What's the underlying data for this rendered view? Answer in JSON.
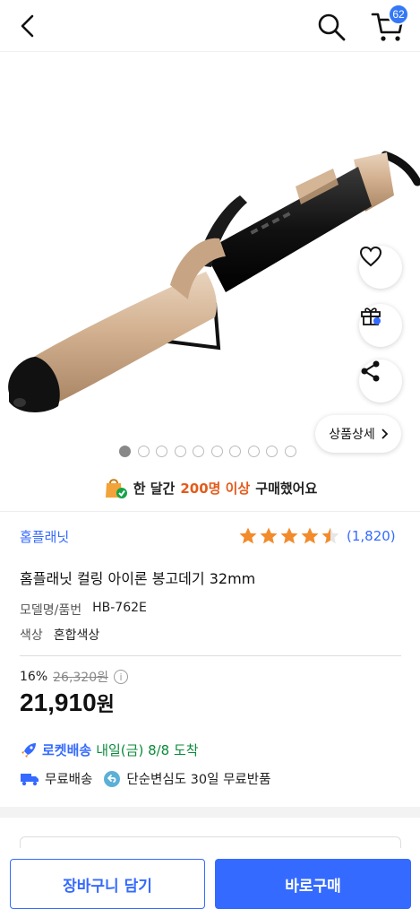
{
  "header": {
    "cart_count": "62"
  },
  "image_detail_label": "상품상세",
  "carousel": {
    "total": 10,
    "active_index": 0
  },
  "social_proof": {
    "prefix": "한 달간",
    "highlight": "200명 이상",
    "suffix": "구매했어요"
  },
  "product": {
    "brand": "홈플래닛",
    "rating": 4.5,
    "review_count": "(1,820)",
    "title": "홈플래닛 컬링 아이론 봉고데기 32mm",
    "model_label": "모델명/품번",
    "model_value": "HB-762E",
    "color_label": "색상",
    "color_value": "혼합색상"
  },
  "pricing": {
    "discount_rate": "16%",
    "original_price": "26,320원",
    "sale_price": "21,910",
    "currency": "원"
  },
  "delivery": {
    "rocket_label": "로켓배송",
    "arrival": "내일(금) 8/8 도착",
    "free_shipping": "무료배송",
    "free_return": "단순변심도 30일 무료반품"
  },
  "actions": {
    "add_to_cart": "장바구니 담기",
    "buy_now": "바로구매"
  },
  "colors": {
    "accent": "#346aff",
    "highlight": "#e35b1a",
    "arrival_green": "#0a8a3a"
  }
}
